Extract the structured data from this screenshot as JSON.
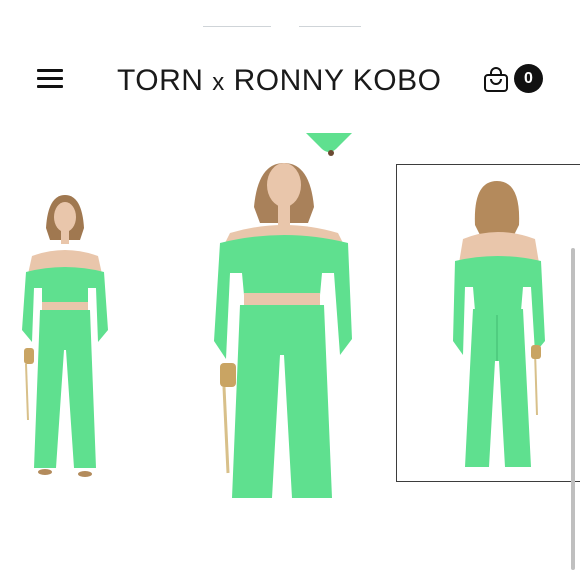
{
  "header": {
    "menu_icon": "hamburger-menu-icon",
    "brand_left": "TORN",
    "brand_x": "x",
    "brand_right": "RONNY KOBO",
    "cart_icon": "shopping-bag-icon",
    "cart_count": "0"
  },
  "gallery": {
    "images": [
      {
        "label": "front-view"
      },
      {
        "label": "front-view-closeup"
      },
      {
        "label": "back-view",
        "selected": true
      }
    ]
  },
  "colors": {
    "outfit_green": "#5fe08f",
    "text": "#1a1a1a",
    "background": "#ffffff"
  }
}
